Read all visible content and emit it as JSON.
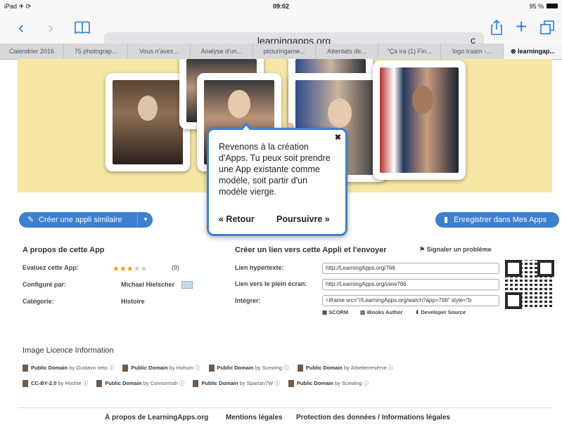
{
  "status": {
    "left": "iPad ✈ ⟳",
    "time": "09:02",
    "battery": "95 %"
  },
  "browser": {
    "url": "learningapps.org"
  },
  "tabs": [
    "Calendrier 2016",
    "75 photograp...",
    "Vous n'avez...",
    "Analyse d'un...",
    "picturingame...",
    "Attentats de...",
    "\"Ça ira (1) Fin...",
    "logo traam -...",
    "learningap..."
  ],
  "popup": {
    "message": "Revenons à la création d'Apps. Tu peux soit prendre une App existante comme modèle, soit partir d'un modèle vierge.",
    "back": "« Retour",
    "next": "Poursuivre »",
    "close": "✖"
  },
  "actions": {
    "create_similar": "Créer une appli similaire",
    "save": "Enregistrer dans Mes Apps"
  },
  "about": {
    "title": "A propos de cette App",
    "rate_label": "Evaluez cette App:",
    "rating_count": "(9)",
    "rating": 3,
    "configured_label": "Configuré par:",
    "configured_value": "Michael Hielscher",
    "category_label": "Catégorie:",
    "category_value": "Histoire"
  },
  "share": {
    "title": "Créer un lien vers cette Appli et l'envoyer",
    "report": "Signaler un problème",
    "hyper_label": "Lien hypertexte:",
    "hyper_value": "http://LearningApps.org/766",
    "full_label": "Lien vers le plein écran:",
    "full_value": "http://LearningApps.org/view766",
    "embed_label": "Intégrer:",
    "embed_value": "<iframe src=\"//LearningApps.org/watch?app=766\" style=\"b",
    "scorm": "SCORM",
    "ibooks": "iBooks Author",
    "dev": "Developer Source"
  },
  "licence": {
    "title": "Image Licence Information",
    "row1": [
      {
        "lic": "Public Domain",
        "by": "by Gustavo neto ⓘ"
      },
      {
        "lic": "Public Domain",
        "by": "by Hohum ⓘ"
      },
      {
        "lic": "Public Domain",
        "by": "by Scewing ⓘ"
      },
      {
        "lic": "Public Domain",
        "by": "by Arbeiterreserve ⓘ"
      }
    ],
    "row2": [
      {
        "lic": "CC-BY-2.0",
        "by": "by Hoshie ⓘ"
      },
      {
        "lic": "Public Domain",
        "by": "by Connormah ⓘ"
      },
      {
        "lic": "Public Domain",
        "by": "by Spartan7W ⓘ"
      },
      {
        "lic": "Public Domain",
        "by": "by Scewing ⓘ"
      }
    ]
  },
  "footer": {
    "about": "À propos de LearningApps.org",
    "legal": "Mentions légales",
    "privacy": "Protection des données / Informations légales"
  }
}
